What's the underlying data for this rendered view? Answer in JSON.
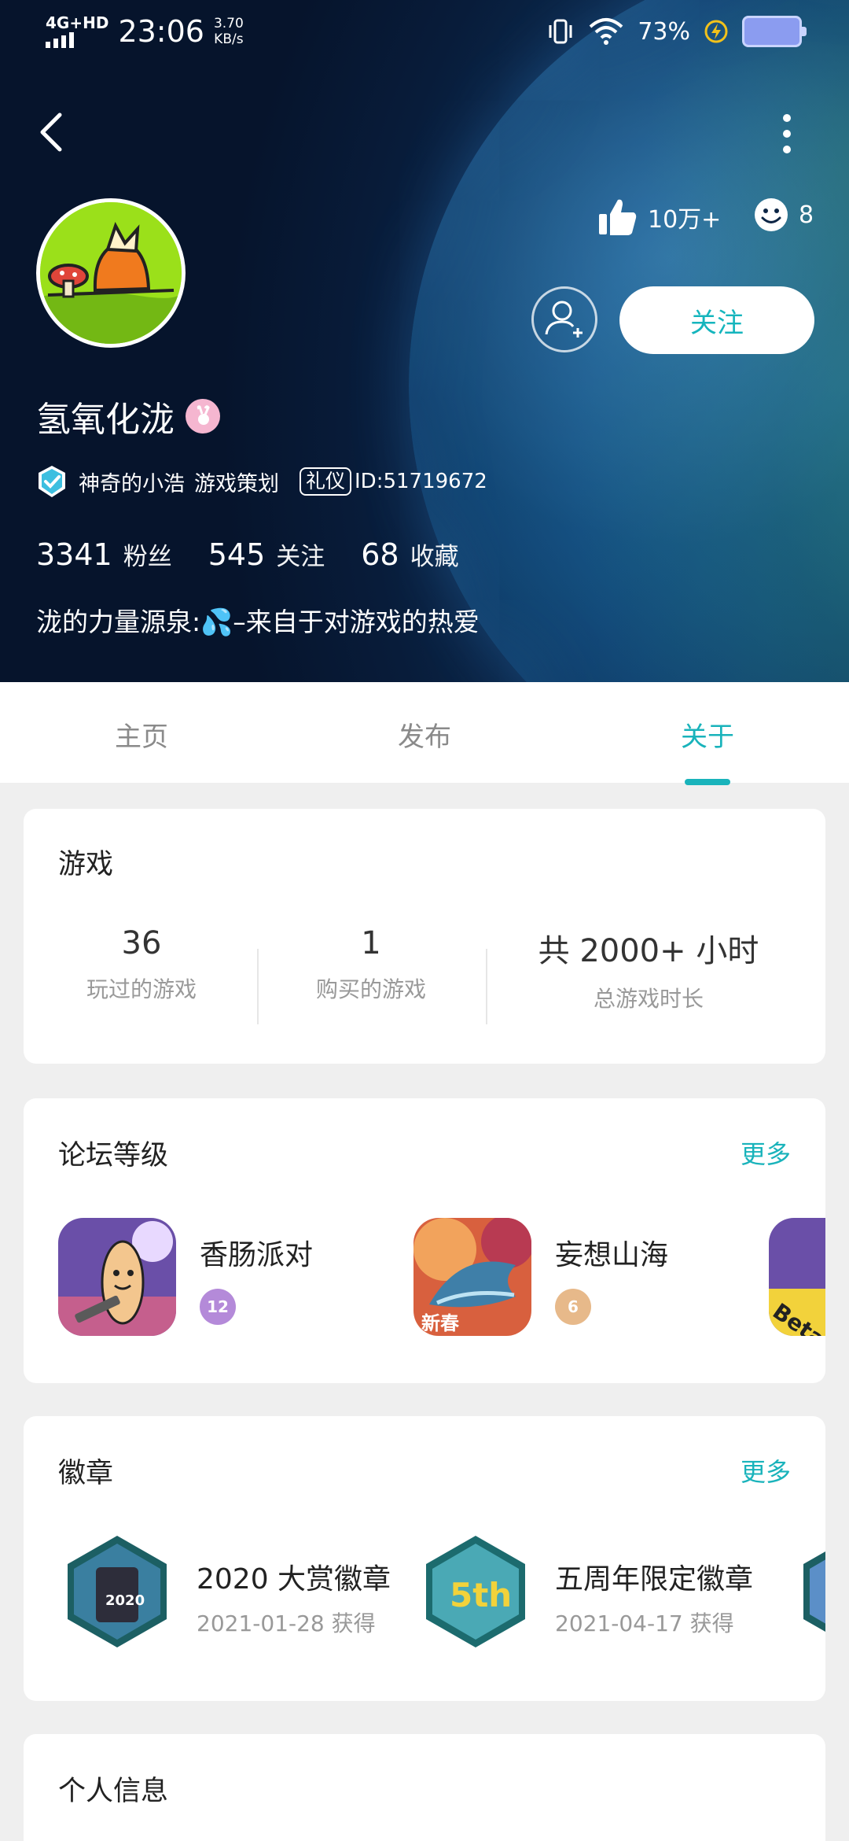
{
  "status_bar": {
    "network": "4G+HD",
    "time": "23:06",
    "speed_value": "3.70",
    "speed_unit": "KB/s",
    "battery_percent": "73%"
  },
  "profile": {
    "likes": "10万+",
    "reactions": "8",
    "follow_label": "关注",
    "username": "氢氧化泷",
    "verified_title": "神奇的小浩",
    "role": "游戏策划",
    "etiquette_tag": "礼仪",
    "user_id": "ID:51719672",
    "signature": "泷的力量源泉:💦–来自于对游戏的热爱",
    "stats": [
      {
        "value": "3341",
        "label": "粉丝"
      },
      {
        "value": "545",
        "label": "关注"
      },
      {
        "value": "68",
        "label": "收藏"
      }
    ]
  },
  "tabs": [
    {
      "label": "主页",
      "active": false
    },
    {
      "label": "发布",
      "active": false
    },
    {
      "label": "关于",
      "active": true
    }
  ],
  "games_card": {
    "title": "游戏",
    "stats": [
      {
        "value": "36",
        "label": "玩过的游戏"
      },
      {
        "value": "1",
        "label": "购买的游戏"
      },
      {
        "value": "共 2000+ 小时",
        "label": "总游戏时长"
      }
    ]
  },
  "forum_card": {
    "title": "论坛等级",
    "more": "更多",
    "items": [
      {
        "name": "香肠派对",
        "level": "12",
        "badge_color": "#b48ad9"
      },
      {
        "name": "妄想山海",
        "level": "6",
        "badge_color": "#e7b98a"
      }
    ],
    "partial_icon_text": "Beta"
  },
  "badges_card": {
    "title": "徽章",
    "more": "更多",
    "items": [
      {
        "name": "2020 大赏徽章",
        "date": "2021-01-28 获得"
      },
      {
        "name": "五周年限定徽章",
        "date": "2021-04-17 获得"
      }
    ],
    "badge_icon_texts": [
      "2020",
      "5th"
    ],
    "forum_icon_texts": [
      "新春"
    ]
  },
  "personal_card": {
    "title": "个人信息"
  },
  "colors": {
    "accent": "#19b3bb",
    "background": "#efefef"
  }
}
